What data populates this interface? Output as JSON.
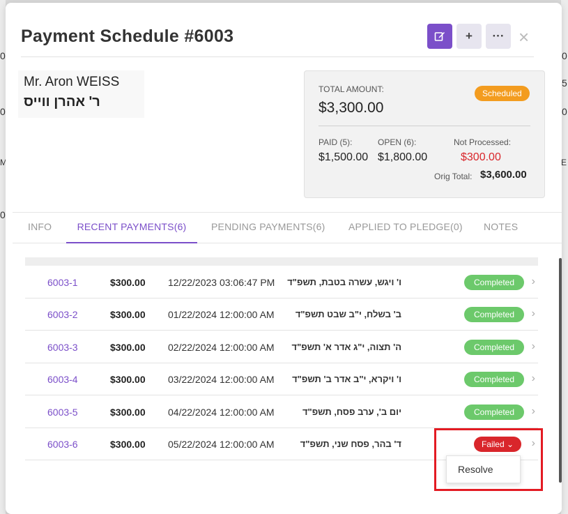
{
  "background": {
    "left_fragments": [
      "0",
      "0",
      "M",
      "0"
    ],
    "right_fragments": [
      "0",
      "5",
      "0",
      "E"
    ]
  },
  "modal": {
    "title": "Payment Schedule #6003",
    "actions": {
      "edit_icon": "edit-icon",
      "add_label": "+",
      "more_label": "···",
      "close_label": "×"
    }
  },
  "donor": {
    "name": "Mr. Aron WEISS",
    "hebrew_name": "ר' אהרן ווייס"
  },
  "summary": {
    "total_label": "TOTAL AMOUNT:",
    "total_value": "$3,300.00",
    "status": "Scheduled",
    "paid_label": "PAID (5):",
    "paid_value": "$1,500.00",
    "open_label": "OPEN (6):",
    "open_value": "$1,800.00",
    "not_processed_label": "Not Processed:",
    "not_processed_value": "$300.00",
    "orig_total_label": "Orig Total:",
    "orig_total_value": "$3,600.00"
  },
  "tabs": [
    {
      "label": "INFO",
      "active": false
    },
    {
      "label": "RECENT PAYMENTS(6)",
      "active": true
    },
    {
      "label": "PENDING PAYMENTS(6)",
      "active": false
    },
    {
      "label": "APPLIED TO PLEDGE(0)",
      "active": false
    },
    {
      "label": "NOTES",
      "active": false
    }
  ],
  "payments": [
    {
      "id": "6003-1",
      "amount": "$300.00",
      "date": "12/22/2023 03:06:47 PM",
      "hebrew_date": "ו' ויגש, עשרה בטבת, תשפ\"ד",
      "status": "Completed"
    },
    {
      "id": "6003-2",
      "amount": "$300.00",
      "date": "01/22/2024 12:00:00 AM",
      "hebrew_date": "ב' בשלח, י\"ב שבט תשפ\"ד",
      "status": "Completed"
    },
    {
      "id": "6003-3",
      "amount": "$300.00",
      "date": "02/22/2024 12:00:00 AM",
      "hebrew_date": "ה' תצוה, י\"ג אדר א' תשפ\"ד",
      "status": "Completed"
    },
    {
      "id": "6003-4",
      "amount": "$300.00",
      "date": "03/22/2024 12:00:00 AM",
      "hebrew_date": "ו' ויקרא, י\"ב אדר ב' תשפ\"ד",
      "status": "Completed"
    },
    {
      "id": "6003-5",
      "amount": "$300.00",
      "date": "04/22/2024 12:00:00 AM",
      "hebrew_date": "יום ב', ערב פסח, תשפ\"ד",
      "status": "Completed"
    },
    {
      "id": "6003-6",
      "amount": "$300.00",
      "date": "05/22/2024 12:00:00 AM",
      "hebrew_date": "ד' בהר, פסח שני, תשפ\"ד",
      "status": "Failed ⌄"
    }
  ],
  "dropdown": {
    "option": "Resolve"
  },
  "colors": {
    "accent": "#7b4fc9",
    "completed": "#6cc96b",
    "failed": "#d9262b",
    "scheduled": "#f39c1f"
  }
}
